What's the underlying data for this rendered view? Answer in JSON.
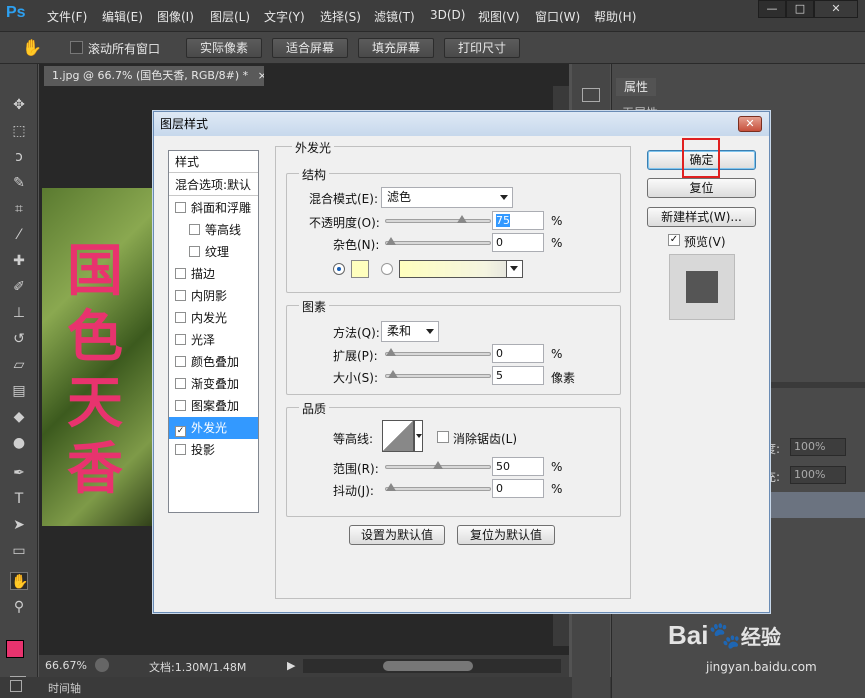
{
  "menubar": {
    "logo": "Ps",
    "items": [
      "文件(F)",
      "编辑(E)",
      "图像(I)",
      "图层(L)",
      "文字(Y)",
      "选择(S)",
      "滤镜(T)",
      "3D(D)",
      "视图(V)",
      "窗口(W)",
      "帮助(H)"
    ],
    "window_buttons": [
      "—",
      "□",
      "✕"
    ]
  },
  "options": {
    "scroll_all_label": "滚动所有窗口",
    "buttons": [
      "实际像素",
      "适合屏幕",
      "填充屏幕",
      "打印尺寸"
    ]
  },
  "document": {
    "tab_title": "1.jpg @ 66.7% (国色天香, RGB/8#) *",
    "tab_close": "×",
    "canvas_text": [
      "国",
      "色",
      "天",
      "香"
    ]
  },
  "status": {
    "zoom": "66.67%",
    "doc_info": "文档:1.30M/1.48M",
    "timeline": "时间轴"
  },
  "right_panel": {
    "properties_tab": "属性",
    "properties_sub": "无属性",
    "opacity_label": "度:",
    "opacity_value": "100%",
    "fill_label": "充:",
    "fill_value": "100%"
  },
  "dialog": {
    "title": "图层样式",
    "close": "✕",
    "style_list": {
      "header": "样式",
      "blend_options": "混合选项:默认",
      "items": [
        {
          "label": "斜面和浮雕",
          "checked": false,
          "indent": false
        },
        {
          "label": "等高线",
          "checked": false,
          "indent": true
        },
        {
          "label": "纹理",
          "checked": false,
          "indent": true
        },
        {
          "label": "描边",
          "checked": false,
          "indent": false
        },
        {
          "label": "内阴影",
          "checked": false,
          "indent": false
        },
        {
          "label": "内发光",
          "checked": false,
          "indent": false
        },
        {
          "label": "光泽",
          "checked": false,
          "indent": false
        },
        {
          "label": "颜色叠加",
          "checked": false,
          "indent": false
        },
        {
          "label": "渐变叠加",
          "checked": false,
          "indent": false
        },
        {
          "label": "图案叠加",
          "checked": false,
          "indent": false
        },
        {
          "label": "外发光",
          "checked": true,
          "indent": false,
          "selected": true
        },
        {
          "label": "投影",
          "checked": false,
          "indent": false
        }
      ]
    },
    "outer_glow": {
      "title": "外发光",
      "structure": {
        "title": "结构",
        "blend_mode_label": "混合模式(E):",
        "blend_mode_value": "滤色",
        "opacity_label": "不透明度(O):",
        "opacity_value": "75",
        "opacity_level": 0.75,
        "opacity_unit": "%",
        "noise_label": "杂色(N):",
        "noise_value": "0",
        "noise_level": 0,
        "noise_unit": "%",
        "glow_color": "#ffffbe"
      },
      "elements": {
        "title": "图素",
        "method_label": "方法(Q):",
        "method_value": "柔和",
        "spread_label": "扩展(P):",
        "spread_value": "0",
        "spread_level": 0,
        "spread_unit": "%",
        "size_label": "大小(S):",
        "size_value": "5",
        "size_level": 0.02,
        "size_unit": "像素"
      },
      "quality": {
        "title": "品质",
        "contour_label": "等高线:",
        "anti_alias_label": "消除锯齿(L)",
        "range_label": "范围(R):",
        "range_value": "50",
        "range_level": 0.5,
        "range_unit": "%",
        "jitter_label": "抖动(J):",
        "jitter_value": "0",
        "jitter_level": 0,
        "jitter_unit": "%"
      },
      "set_default": "设置为默认值",
      "reset_default": "复位为默认值"
    },
    "buttons": {
      "ok": "确定",
      "reset": "复位",
      "new_style": "新建样式(W)...",
      "preview": "预览(V)"
    }
  },
  "watermark": {
    "brand": "Bai",
    "brand2": "经验",
    "url": "jingyan.baidu.com"
  },
  "colors": {
    "foreground": "#e8336e",
    "background": "#ffffff",
    "highlight_box": "#e02020"
  }
}
